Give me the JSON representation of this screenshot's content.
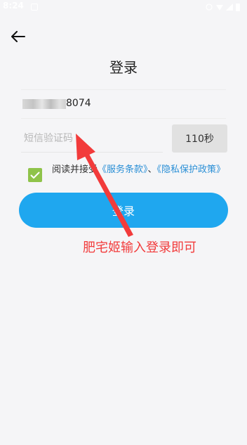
{
  "status_bar": {
    "time": "8:24"
  },
  "header": {
    "title": "登录"
  },
  "phone": {
    "visible_suffix": "8074"
  },
  "code": {
    "placeholder": "短信验证码"
  },
  "countdown": {
    "label": "110秒"
  },
  "agreement": {
    "checked": true,
    "prefix": "阅读并接受",
    "service_link": "《服务条款》",
    "separator": "、",
    "privacy_link": "《隐私保护政策》"
  },
  "login_button": {
    "label": "登录"
  },
  "annotation": {
    "text": "肥宅姬输入登录即可",
    "color": "#f23b3b"
  },
  "colors": {
    "accent": "#1fa7ef",
    "check": "#8fc34a",
    "link": "#2a8fd6"
  }
}
